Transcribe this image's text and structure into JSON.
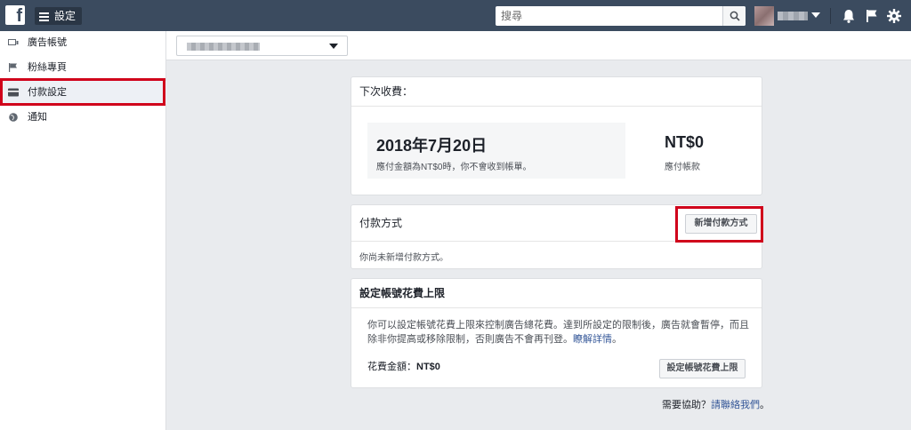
{
  "topbar": {
    "logo": "f",
    "menu_label": "設定",
    "search_placeholder": "搜尋"
  },
  "sidebar": {
    "items": [
      {
        "label": "廣告帳號",
        "icon": "ad-account-icon"
      },
      {
        "label": "粉絲專頁",
        "icon": "flag-icon"
      },
      {
        "label": "付款設定",
        "icon": "credit-card-icon",
        "active": true
      },
      {
        "label": "通知",
        "icon": "globe-icon"
      }
    ]
  },
  "next_charge": {
    "heading": "下次收費：",
    "date": "2018年7月20日",
    "note": "應付金額為NT$0時，你不會收到帳單。",
    "amount": "NT$0",
    "amount_label": "應付帳款"
  },
  "payment_methods": {
    "heading": "付款方式",
    "add_button": "新增付款方式",
    "empty_text": "你尚未新增付款方式。"
  },
  "spend_limit": {
    "heading": "設定帳號花費上限",
    "description": "你可以設定帳號花費上限來控制廣告總花費。達到所設定的限制後，廣告就會暫停，而且除非你提高或移除限制，否則廣告不會再刊登。",
    "learn_more": "瞭解詳情",
    "learn_more_suffix": "。",
    "amount_label": "花費金額：",
    "amount_value": "NT$0",
    "button": "設定帳號花費上限"
  },
  "help": {
    "prefix": "需要協助？",
    "link": "請聯絡我們",
    "suffix": "。"
  },
  "colors": {
    "topbar": "#3b4b5f",
    "highlight": "#d0021b",
    "link": "#365899"
  }
}
